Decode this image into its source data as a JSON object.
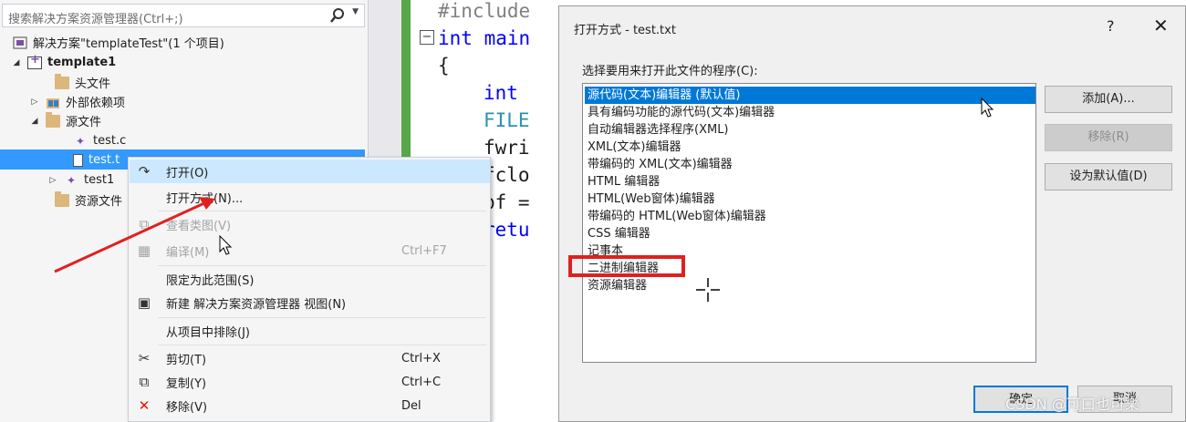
{
  "solution_explorer": {
    "search_placeholder": "搜索解决方案资源管理器(Ctrl+;)",
    "items": [
      {
        "label": "解决方案\"templateTest\"(1 个项目)",
        "icon": "solution-icon",
        "expander": ""
      },
      {
        "label": "template1",
        "icon": "project-icon",
        "expander": "◢"
      },
      {
        "label": "头文件",
        "icon": "folder-icon",
        "expander": ""
      },
      {
        "label": "外部依赖项",
        "icon": "external-deps-icon",
        "expander": "▷"
      },
      {
        "label": "源文件",
        "icon": "folder-icon",
        "expander": "◢"
      },
      {
        "label": "test.c",
        "icon": "cpp-file-icon",
        "expander": ""
      },
      {
        "label": "test.t",
        "icon": "text-file-icon",
        "expander": ""
      },
      {
        "label": "test1",
        "icon": "cpp-file-icon",
        "expander": "▷"
      },
      {
        "label": "资源文件",
        "icon": "folder-icon",
        "expander": ""
      }
    ]
  },
  "context_menu": {
    "items": [
      {
        "label": "打开(O)",
        "shortcut": "",
        "icon": "open-icon",
        "disabled": false
      },
      {
        "label": "打开方式(N)...",
        "shortcut": "",
        "icon": "",
        "disabled": false
      },
      {
        "label": "查看类图(V)",
        "shortcut": "",
        "icon": "class-diagram-icon",
        "disabled": true
      },
      {
        "label": "编译(M)",
        "shortcut": "Ctrl+F7",
        "icon": "compile-icon",
        "disabled": true
      },
      {
        "label": "限定为此范围(S)",
        "shortcut": "",
        "icon": "",
        "disabled": false
      },
      {
        "label": "新建 解决方案资源管理器 视图(N)",
        "shortcut": "",
        "icon": "new-view-icon",
        "disabled": false
      },
      {
        "label": "从项目中排除(J)",
        "shortcut": "",
        "icon": "",
        "disabled": false
      },
      {
        "label": "剪切(T)",
        "shortcut": "Ctrl+X",
        "icon": "cut-icon",
        "disabled": false
      },
      {
        "label": "复制(Y)",
        "shortcut": "Ctrl+C",
        "icon": "copy-icon",
        "disabled": false
      },
      {
        "label": "移除(V)",
        "shortcut": "Del",
        "icon": "remove-icon",
        "disabled": false
      }
    ]
  },
  "code_editor": {
    "lines": [
      "#include",
      "int main",
      "{",
      "int",
      "FILE",
      "fwri",
      "fclo",
      "pf =",
      "retu"
    ]
  },
  "dialog": {
    "title": "打开方式 - test.txt",
    "help": "?",
    "close": "✕",
    "prompt": "选择要用来打开此文件的程序(C):",
    "programs": [
      "源代码(文本)编辑器 (默认值)",
      "具有编码功能的源代码(文本)编辑器",
      "自动编辑器选择程序(XML)",
      "XML(文本)编辑器",
      "带编码的 XML(文本)编辑器",
      "HTML 编辑器",
      "HTML(Web窗体)编辑器",
      "带编码的 HTML(Web窗体)编辑器",
      "CSS 编辑器",
      "记事本",
      "二进制编辑器",
      "资源编辑器"
    ],
    "selected_index": 0,
    "highlighted_program": "二进制编辑器",
    "buttons": {
      "add": "添加(A)...",
      "remove": "移除(R)",
      "set_default": "设为默认值(D)",
      "ok": "确定",
      "cancel": "取消"
    }
  },
  "watermark": "CSDN @可口也可樂",
  "colors": {
    "selection": "#3399ff",
    "dialog_selection": "#0078d7",
    "annotation": "#e02020"
  }
}
